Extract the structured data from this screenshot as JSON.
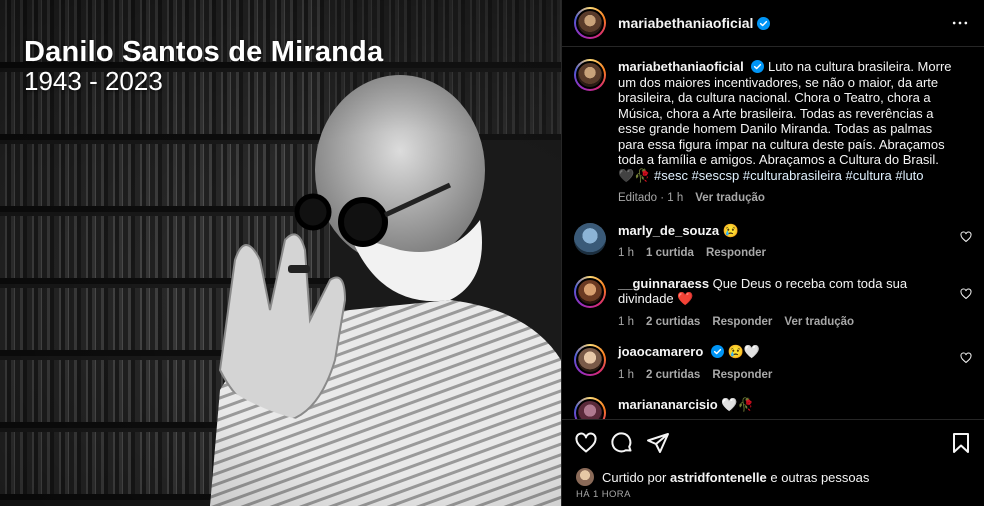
{
  "photo": {
    "title": "Danilo Santos de Miranda",
    "years": "1943 - 2023"
  },
  "header": {
    "username": "mariabethaniaoficial",
    "verified": true
  },
  "caption": {
    "username": "mariabethaniaoficial",
    "text": "Luto na cultura brasileira. Morre um dos maiores incentivadores, se não o maior, da arte brasileira, da cultura nacional. Chora o Teatro, chora a Música, chora a Arte brasileira. Todas as reverências a esse grande homem Danilo Miranda. Todas as palmas para essa figura ímpar na cultura deste país. Abraçamos toda a família e amigos. Abraçamos a Cultura do Brasil. 🖤🥀",
    "hashtags": "#sesc #sescsp #culturabrasileira #cultura #luto",
    "edited": "Editado",
    "time": "1 h",
    "translate": "Ver tradução"
  },
  "comments": [
    {
      "username": "marly_de_souza",
      "text": "😢",
      "verified": false,
      "time": "1 h",
      "likes": "1 curtida",
      "reply": "Responder",
      "translate": ""
    },
    {
      "username": "__guinnaraess",
      "text": "Que Deus o receba com toda sua divindade ❤️",
      "verified": false,
      "time": "1 h",
      "likes": "2 curtidas",
      "reply": "Responder",
      "translate": "Ver tradução"
    },
    {
      "username": "joaocamarero",
      "text": "😢🤍",
      "verified": true,
      "time": "1 h",
      "likes": "2 curtidas",
      "reply": "Responder",
      "translate": ""
    },
    {
      "username": "mariananarcisio",
      "text": "🤍🥀",
      "verified": false,
      "time": "",
      "likes": "",
      "reply": "",
      "translate": ""
    }
  ],
  "likes": {
    "prefix": "Curtido por",
    "user": "astridfontenelle",
    "suffix": "e outras pessoas"
  },
  "timestamp": "HÁ 1 HORA",
  "colors": {
    "verified": "#0095f6",
    "heart": "#ff3040"
  }
}
